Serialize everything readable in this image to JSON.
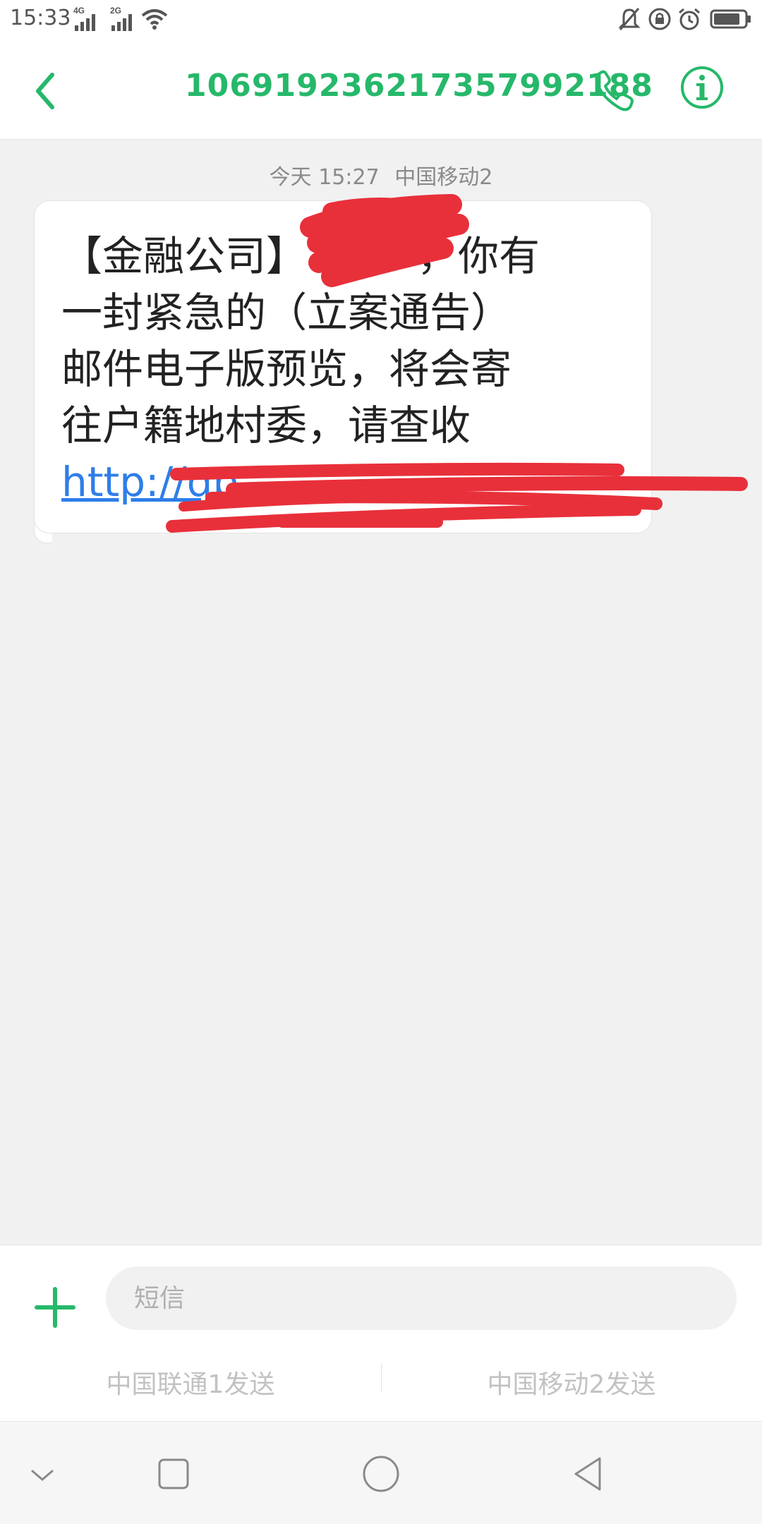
{
  "status_bar": {
    "time": "15:33",
    "signal1_label": "4G",
    "signal2_label": "2G",
    "icons": [
      "signal-icon",
      "wifi-icon",
      "mute-icon",
      "lock-rotation-icon",
      "alarm-icon",
      "battery-icon"
    ]
  },
  "header": {
    "contact_number": "106919236217357992188",
    "icons": [
      "back-icon",
      "phone-icon",
      "info-icon"
    ]
  },
  "conversation": {
    "timestamp_day": "今天 15:27",
    "timestamp_carrier": "中国移动2",
    "message": {
      "line1_prefix": "【金融公司】",
      "line1_suffix": "，你有",
      "line2": "一封紧急的（立案通告）",
      "line3": "邮件电子版预览，将会寄",
      "line4": "往户籍地村委，请查收",
      "link": "http://qp"
    },
    "redaction_color": "#e8303a"
  },
  "composer": {
    "placeholder": "短信",
    "send_sim1": "中国联通1发送",
    "send_sim2": "中国移动2发送"
  },
  "theme": {
    "accent": "#26b86a",
    "link": "#2e7ee8"
  },
  "nav_bar": {
    "icons": [
      "hide-keyboard-icon",
      "recents-icon",
      "home-icon",
      "back-nav-icon"
    ]
  }
}
